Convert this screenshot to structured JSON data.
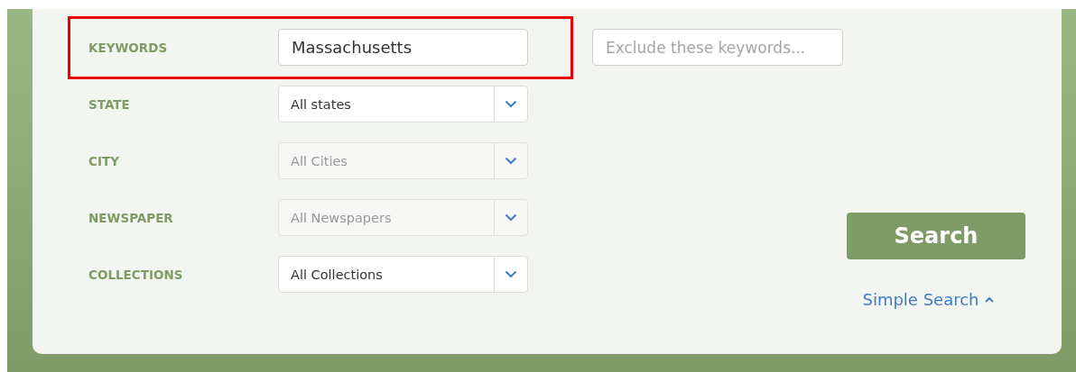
{
  "fields": [
    {
      "label": "KEYWORDS",
      "kind": "text",
      "value": "Massachusetts",
      "highlighted": true
    },
    {
      "label": "STATE",
      "kind": "select",
      "value": "All states",
      "highlighted": false,
      "disabled": false
    },
    {
      "label": "CITY",
      "kind": "select",
      "value": "All Cities",
      "highlighted": false,
      "disabled": true
    },
    {
      "label": "NEWSPAPER",
      "kind": "select",
      "value": "All Newspapers",
      "highlighted": false,
      "disabled": true
    },
    {
      "label": "COLLECTIONS",
      "kind": "select",
      "value": "All Collections",
      "highlighted": false,
      "disabled": false
    }
  ],
  "exclude": {
    "placeholder": "Exclude these keywords..."
  },
  "search_button": "Search",
  "simple_search_link": "Simple Search"
}
